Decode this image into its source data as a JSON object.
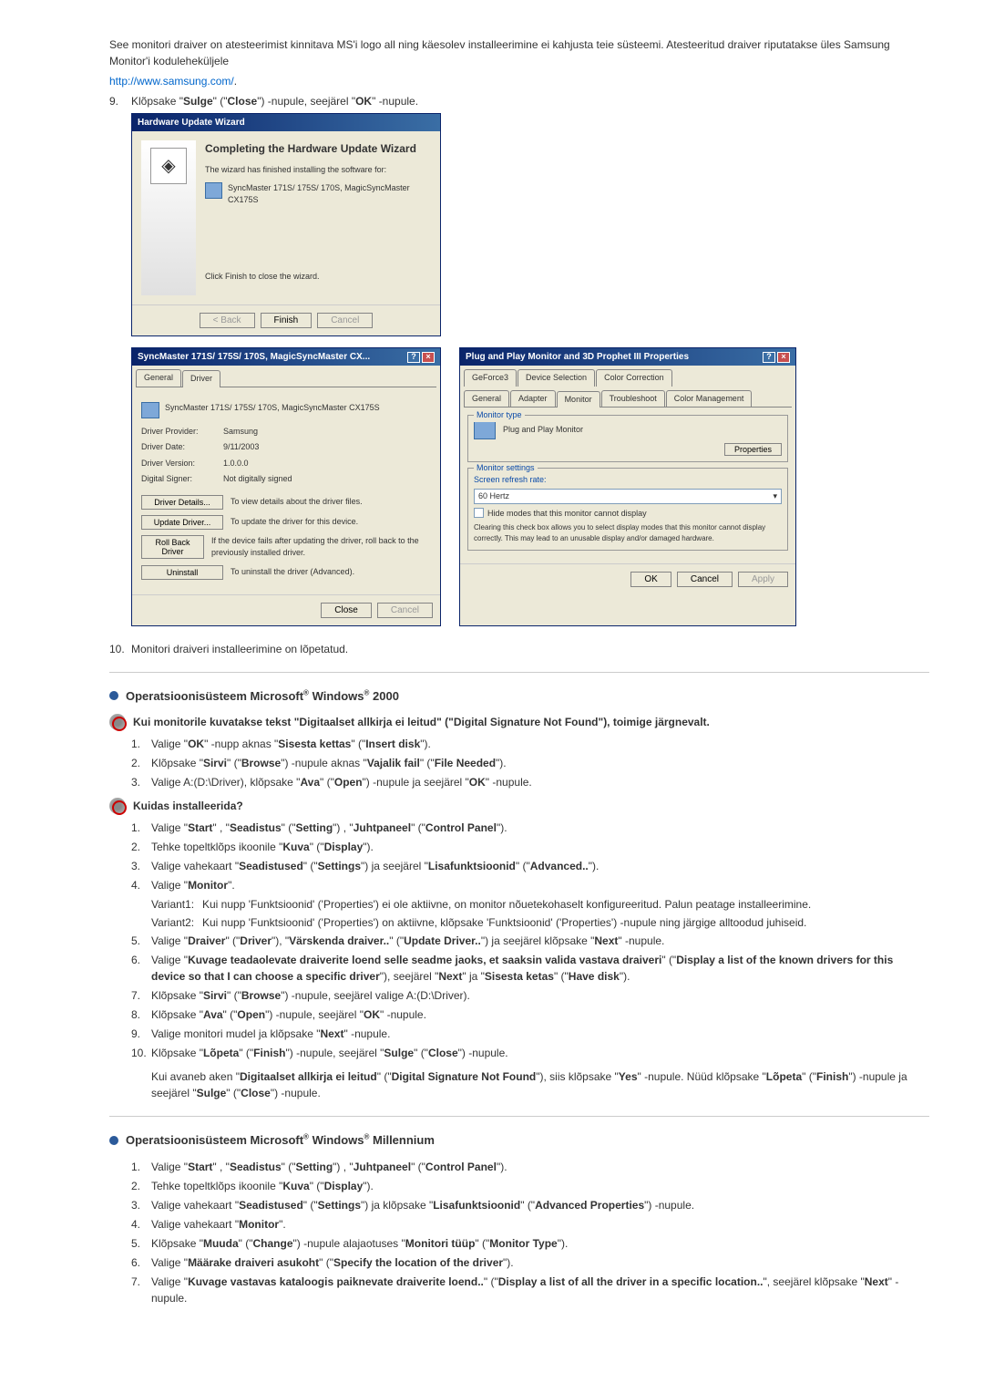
{
  "intro": {
    "para": "See monitori draiver on atesteerimist kinnitava MS'i logo all ning käesolev installeerimine ei kahjusta teie süsteemi. Atesteeritud draiver riputatakse üles Samsung Monitor'i koduleheküljele",
    "link": "http://www.samsung.com/",
    "linkdot": ".",
    "item9num": "9.",
    "item9": "Klõpsake \"Sulge\" (\"Close\") -nupule, seejärel \"OK\" -nupule."
  },
  "wizard": {
    "title": "Hardware Update Wizard",
    "heading": "Completing the Hardware Update Wizard",
    "line1": "The wizard has finished installing the software for:",
    "product": "SyncMaster 171S/ 175S/ 170S, MagicSyncMaster CX175S",
    "line2": "Click Finish to close the wizard.",
    "btn_back": "< Back",
    "btn_finish": "Finish",
    "btn_cancel": "Cancel"
  },
  "driverProps": {
    "title": "SyncMaster 171S/ 175S/ 170S, MagicSyncMaster CX...",
    "tab_general": "General",
    "tab_driver": "Driver",
    "product": "SyncMaster 171S/ 175S/ 170S, MagicSyncMaster CX175S",
    "provider_lbl": "Driver Provider:",
    "provider_val": "Samsung",
    "date_lbl": "Driver Date:",
    "date_val": "9/11/2003",
    "version_lbl": "Driver Version:",
    "version_val": "1.0.0.0",
    "signer_lbl": "Digital Signer:",
    "signer_val": "Not digitally signed",
    "btn_details": "Driver Details...",
    "desc_details": "To view details about the driver files.",
    "btn_update": "Update Driver...",
    "desc_update": "To update the driver for this device.",
    "btn_rollback": "Roll Back Driver",
    "desc_rollback": "If the device fails after updating the driver, roll back to the previously installed driver.",
    "btn_uninstall": "Uninstall",
    "desc_uninstall": "To uninstall the driver (Advanced).",
    "btn_close": "Close",
    "btn_cancel": "Cancel"
  },
  "monitorProps": {
    "title": "Plug and Play Monitor and 3D Prophet III Properties",
    "tabs_top": [
      "GeForce3",
      "Device Selection",
      "Color Correction"
    ],
    "tabs_mid": [
      "General",
      "Adapter",
      "Monitor",
      "Troubleshoot",
      "Color Management"
    ],
    "legend_type": "Monitor type",
    "mon_name": "Plug and Play Monitor",
    "btn_properties": "Properties",
    "legend_settings": "Monitor settings",
    "refresh_lbl": "Screen refresh rate:",
    "refresh_val": "60 Hertz",
    "checkbox_lbl": "Hide modes that this monitor cannot display",
    "note": "Clearing this check box allows you to select display modes that this monitor cannot display correctly. This may lead to an unusable display and/or damaged hardware.",
    "btn_ok": "OK",
    "btn_cancel": "Cancel",
    "btn_apply": "Apply"
  },
  "item10": {
    "num": "10.",
    "txt": "Monitori draiveri installeerimine on lõpetatud."
  },
  "win2000": {
    "title_pre": "Operatsioonisüsteem Microsoft",
    "title_mid": " Windows",
    "title_suf": " 2000",
    "sig_not_found": "Kui monitorile kuvatakse tekst \"Digitaalset allkirja ei leitud\" (\"Digital Signature Not Found\"), toimige järgnevalt.",
    "steps_sig": [
      "Valige \"OK\" -nupp aknas \"Sisesta kettas\" (\"Insert disk\").",
      "Klõpsake \"Sirvi\" (\"Browse\") -nupule aknas \"Vajalik fail\" (\"File Needed\").",
      "Valige A:(D:\\Driver), klõpsake \"Ava\" (\"Open\") -nupule ja seejärel \"OK\" -nupule."
    ],
    "howto_title": "Kuidas installeerida?",
    "steps": [
      "Valige \"Start\" , \"Seadistus\" (\"Setting\") , \"Juhtpaneel\" (\"Control Panel\").",
      "Tehke topeltklõps ikoonile \"Kuva\" (\"Display\").",
      "Valige vahekaart \"Seadistused\" (\"Settings\") ja seejärel \"Lisafunktsioonid\" (\"Advanced..\").",
      "Valige \"Monitor\"."
    ],
    "variant1_lbl": "Variant1:",
    "variant1": "Kui nupp 'Funktsioonid' ('Properties') ei ole aktiivne, on monitor nõuetekohaselt konfigureeritud. Palun peatage installeerimine.",
    "variant2_lbl": "Variant2:",
    "variant2": "Kui nupp 'Funktsioonid' ('Properties') on aktiivne, klõpsake 'Funktsioonid' ('Properties') -nupule ning järgige alltoodud juhiseid.",
    "steps2": [
      "Valige \"Draiver\" (\"Driver\"), \"Värskenda draiver..\" (\"Update Driver..\") ja seejärel klõpsake \"Next\" -nupule.",
      "Valige \"Kuvage teadaolevate draiverite loend selle seadme jaoks, et saaksin valida vastava draiveri\" (\"Display a list of the known drivers for this device so that I can choose a specific driver\"), seejärel \"Next\" ja \"Sisesta ketas\" (\"Have disk\").",
      "Klõpsake \"Sirvi\" (\"Browse\") -nupule, seejärel valige A:(D:\\Driver).",
      "Klõpsake \"Ava\" (\"Open\") -nupule, seejärel \"OK\" -nupule.",
      "Valige monitori mudel ja klõpsake \"Next\" -nupule.",
      "Klõpsake \"Lõpeta\" (\"Finish\") -nupule, seejärel \"Sulge\" (\"Close\") -nupule."
    ],
    "note": "Kui avaneb aken \"Digitaalset allkirja ei leitud\" (\"Digital Signature Not Found\"), siis klõpsake \"Yes\" -nupule. Nüüd klõpsake \"Lõpeta\" (\"Finish\") -nupule ja seejärel \"Sulge\" (\"Close\") -nupule."
  },
  "winme": {
    "title_pre": "Operatsioonisüsteem Microsoft",
    "title_mid": " Windows",
    "title_suf": " Millennium",
    "steps": [
      "Valige \"Start\" , \"Seadistus\" (\"Setting\") , \"Juhtpaneel\" (\"Control Panel\").",
      "Tehke topeltklõps ikoonile \"Kuva\" (\"Display\").",
      "Valige vahekaart \"Seadistused\" (\"Settings\") ja klõpsake \"Lisafunktsioonid\" (\"Advanced Properties\") -nupule.",
      "Valige vahekaart \"Monitor\".",
      "Klõpsake \"Muuda\" (\"Change\") -nupule alajaotuses \"Monitori tüüp\" (\"Monitor Type\").",
      "Valige \"Määrake draiveri asukoht\" (\"Specify the location of the driver\").",
      "Valige \"Kuvage vastavas kataloogis paiknevate draiverite loend..\" (\"Display a list of all the driver in a specific location..\", seejärel klõpsake \"Next\" -nupule."
    ]
  }
}
